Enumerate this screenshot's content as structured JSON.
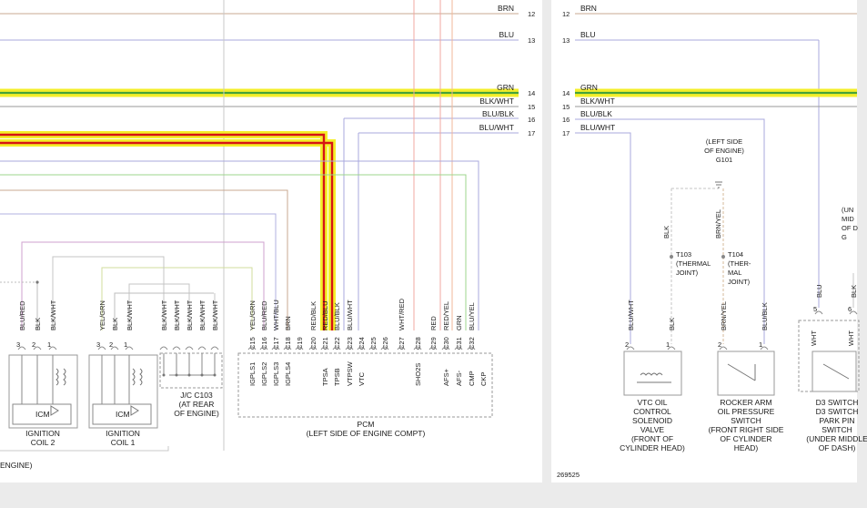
{
  "left_wires": [
    {
      "num": "12",
      "color": "BRN"
    },
    {
      "num": "13",
      "color": "BLU"
    },
    {
      "num": "14",
      "color": "GRN"
    },
    {
      "num": "15",
      "color": "BLK/WHT"
    },
    {
      "num": "16",
      "color": "BLU/BLK"
    },
    {
      "num": "17",
      "color": "BLU/WHT"
    }
  ],
  "right_wires": [
    {
      "num": "12",
      "color": "BRN"
    },
    {
      "num": "13",
      "color": "BLU"
    },
    {
      "num": "14",
      "color": "GRN"
    },
    {
      "num": "15",
      "color": "BLK/WHT"
    },
    {
      "num": "16",
      "color": "BLU/BLK"
    },
    {
      "num": "17",
      "color": "BLU/WHT"
    }
  ],
  "coil2": {
    "wire_colors": [
      "BLU/RED",
      "BLK",
      "BLK/WHT"
    ],
    "pins": [
      "3",
      "2",
      "1"
    ],
    "icm": "ICM",
    "label": "IGNITION\nCOIL 2"
  },
  "coil1": {
    "wire_colors": [
      "YEL/GRN",
      "BLK",
      "BLK/WHT"
    ],
    "pins": [
      "3",
      "2",
      "1"
    ],
    "icm": "ICM",
    "label": "IGNITION\nCOIL 1"
  },
  "jc_c103": {
    "wire_colors": [
      "BLK/WHT",
      "BLK/WHT",
      "BLK/WHT",
      "BLK/WHT",
      "BLK/WHT"
    ],
    "label": "J/C C103\n(AT REAR\nOF ENGINE)"
  },
  "pcm": {
    "wire_colors": [
      "YEL/GRN",
      "BLU/RED",
      "WHT/BLU",
      "BRN",
      "",
      "RED/BLK",
      "RED/BLU",
      "BLU/BLK",
      "BLU/WHT",
      "",
      "",
      "",
      "WHT/RED",
      "RED",
      "RED/YEL",
      "GRN",
      "BLU/YEL"
    ],
    "pins": [
      "C15",
      "C16",
      "C17",
      "C18",
      "C19",
      "C20",
      "C21",
      "C22",
      "C23",
      "C24",
      "C25",
      "C26",
      "C27",
      "C28",
      "C29",
      "C30",
      "C31",
      "C32"
    ],
    "signals": [
      "IGPLS1",
      "IGPLS2",
      "IGPLS3",
      "IGPLS4",
      "TPSA",
      "TPSB",
      "VTPSW",
      "VTC",
      "SHO2S",
      "AFS+",
      "AFS-",
      "CMP",
      "CKP"
    ],
    "label": "PCM\n(LEFT SIDE OF ENGINE COMPT)"
  },
  "bottom_left_text": "ENGINE)",
  "ground": {
    "label": "(LEFT SIDE\nOF ENGINE)\nG101"
  },
  "t103": {
    "wire_color": "BLK",
    "label": "T103\n(THERMAL\nJOINT)"
  },
  "t104": {
    "wire_color": "BRN/YEL",
    "label": "T104\n(THER-\nMAL\nJOINT)"
  },
  "vtc_valve": {
    "wire_colors": [
      "BLU/WHT",
      "BLK"
    ],
    "pins": [
      "2",
      "1"
    ],
    "label": "VTC OIL\nCONTROL\nSOLENOID\nVALVE\n(FRONT OF\nCYLINDER HEAD)"
  },
  "rocker_switch": {
    "wire_colors": [
      "BRN/YEL",
      "BLU/BLK"
    ],
    "pins": [
      "2",
      "1"
    ],
    "label": "ROCKER ARM\nOIL PRESSURE\nSWITCH\n(FRONT RIGHT SIDE\nOF CYLINDER\nHEAD)"
  },
  "d3_switch": {
    "wire_colors": [
      "WHT",
      "BLU",
      "WHT",
      "BLK"
    ],
    "pins": [
      "5",
      "6"
    ],
    "label": "D3 SWITCH\nD3 SWITCH\nPARK PIN\nSWITCH\n(UNDER MIDDLE\nOF DASH)"
  },
  "right_edge_text": "(UN\nMID\nOF D\nG",
  "figure_number": "269525"
}
